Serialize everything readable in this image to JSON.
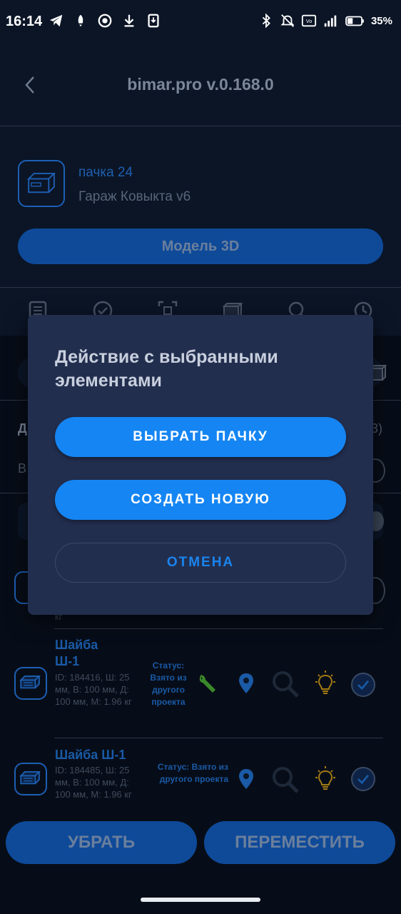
{
  "status_bar": {
    "time": "16:14",
    "battery": "35%",
    "left_icons": [
      "telegram-icon",
      "notification-icon",
      "record-icon",
      "download-icon",
      "save-icon"
    ],
    "right_icons": [
      "bluetooth-icon",
      "mute-icon",
      "volte-icon",
      "signal-icon",
      "battery-icon"
    ]
  },
  "header": {
    "title": "bimar.pro v.0.168.0"
  },
  "project": {
    "title": "пачка 24",
    "subtitle": "Гараж Ковыкта v6",
    "model_button": "Модель 3D"
  },
  "tabs": [
    "list-icon",
    "check-icon",
    "scan-icon",
    "box-icon",
    "search-icon",
    "history-icon"
  ],
  "background": {
    "section_label": "Д",
    "row_label": "В",
    "count_fragment": "3)"
  },
  "items": [
    {
      "name": "Шайба Ш-1",
      "desc": "ID: 184416, Ш: 25 мм, В: 100 мм, Д: 100 мм, М: 1.96 кг",
      "status": "Статус: Взято из другого проекта"
    },
    {
      "name": "Шайба Ш-1",
      "desc": "ID: 184485, Ш: 25 мм, В: 100 мм, Д: 100 мм, М: 1.96 кг",
      "status": "Статус: Взято из другого проекта"
    }
  ],
  "partial_item": {
    "desc_tail": "кг"
  },
  "bottom_buttons": {
    "remove": "УБРАТЬ",
    "move": "ПЕРЕМЕСТИТЬ"
  },
  "dialog": {
    "title": "Действие с выбранными элементами",
    "select_pack": "ВЫБРАТЬ ПАЧКУ",
    "create_new": "СОЗДАТЬ НОВУЮ",
    "cancel": "ОТМЕНА"
  },
  "colors": {
    "background": "#0b1526",
    "dialog": "#222e4e",
    "primary": "#1585f3",
    "accent_blue": "#1a5aa6"
  }
}
